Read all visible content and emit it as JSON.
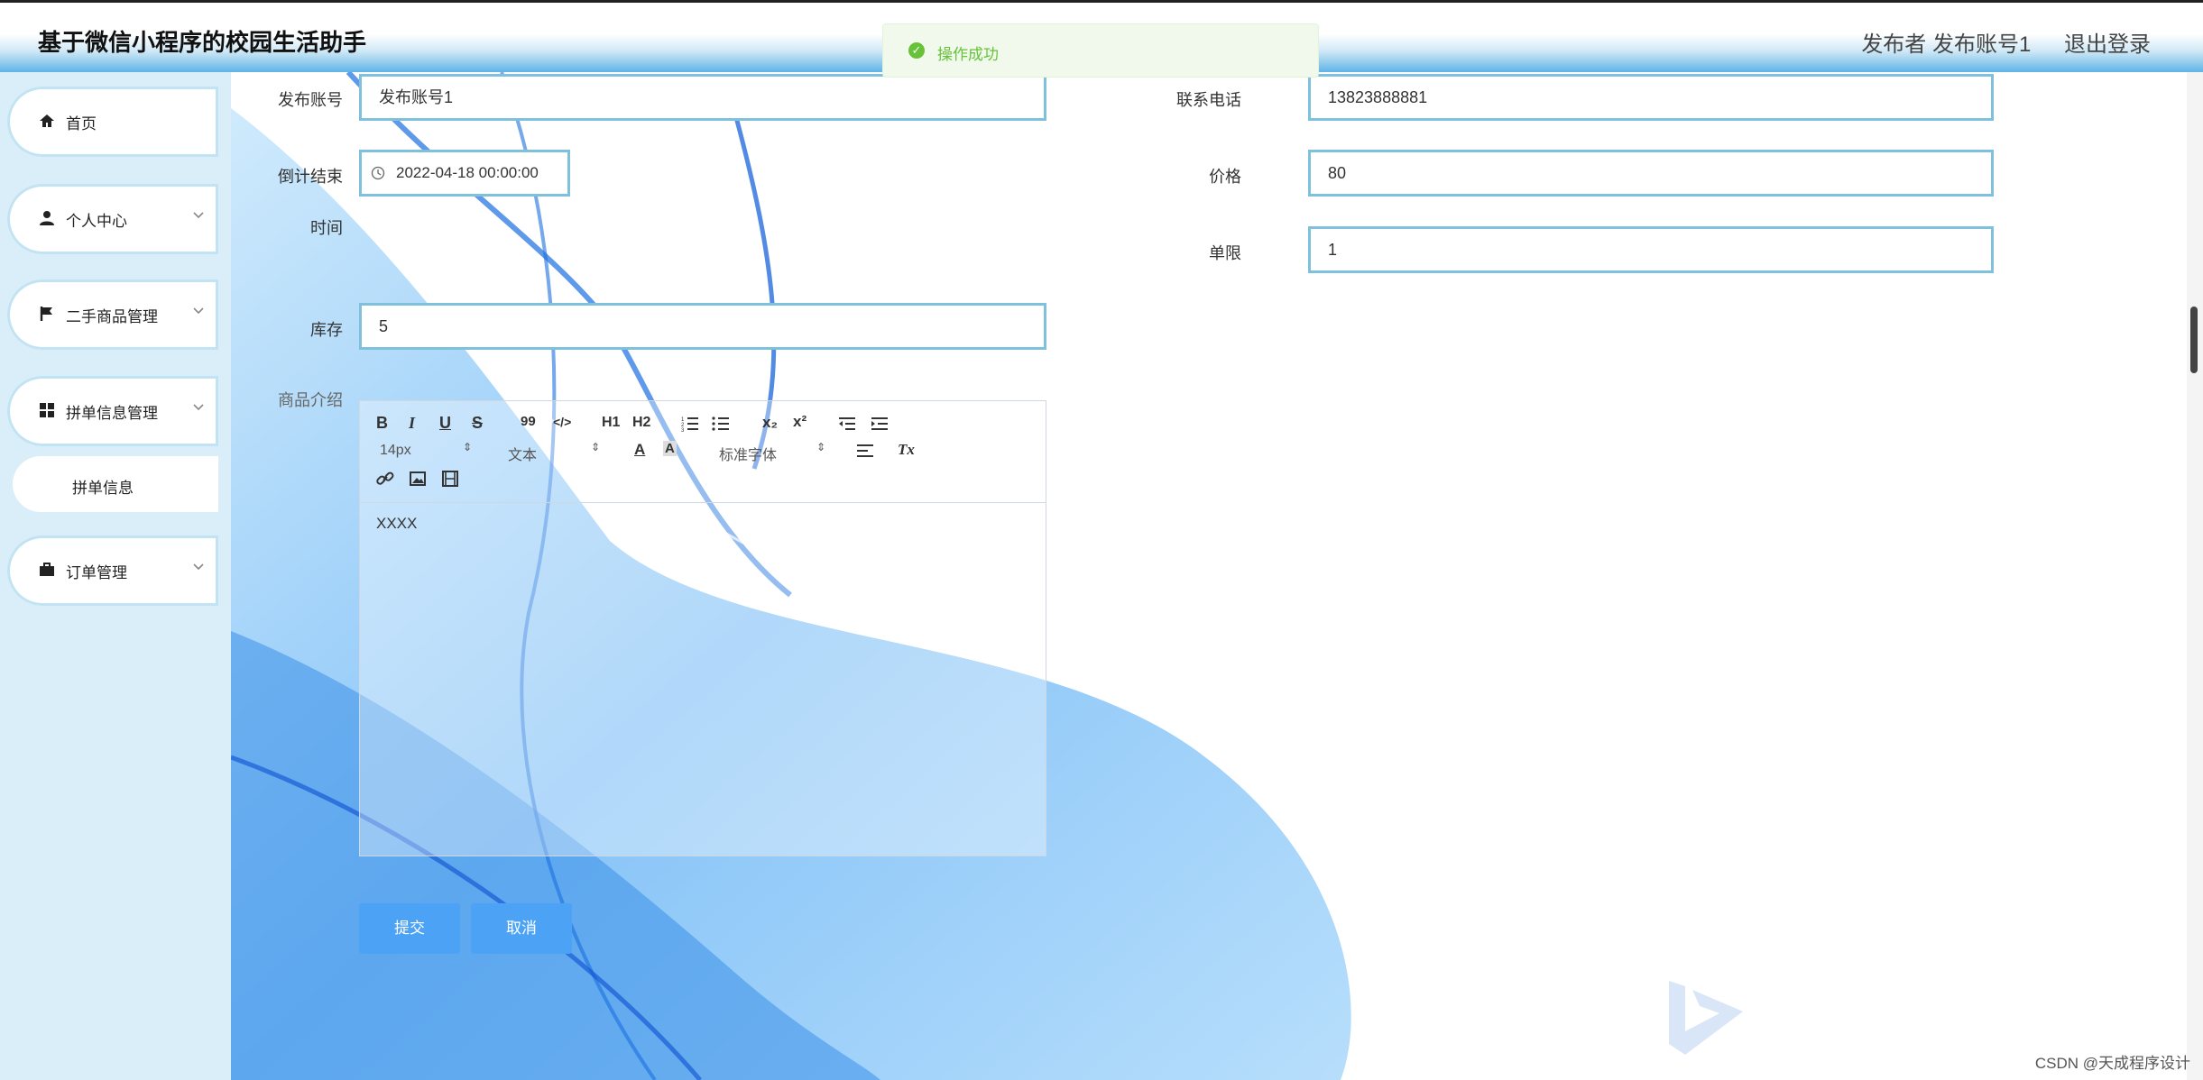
{
  "header": {
    "title": "基于微信小程序的校园生活助手",
    "user": "发布者 发布账号1",
    "logout": "退出登录"
  },
  "toast": {
    "message": "操作成功",
    "color": "#67c23a"
  },
  "sidebar": {
    "items": [
      {
        "label": "首页",
        "icon": "home-icon"
      },
      {
        "label": "个人中心",
        "icon": "user-icon"
      },
      {
        "label": "二手商品管理",
        "icon": "flag-icon"
      },
      {
        "label": "拼单信息管理",
        "icon": "grid-icon"
      },
      {
        "label": "订单管理",
        "icon": "briefcase-icon"
      }
    ],
    "sub_item": "拼单信息"
  },
  "form": {
    "account_label": "发布账号",
    "account_value": "发布账号1",
    "phone_label": "联系电话",
    "phone_value": "13823888881",
    "countdown_label_1": "倒计结束",
    "countdown_label_2": "时间",
    "countdown_value": "2022-04-18 00:00:00",
    "price_label": "价格",
    "price_value": "80",
    "limit_label": "单限",
    "limit_value": "1",
    "stock_label": "库存",
    "stock_value": "5",
    "intro_label": "商品介绍",
    "intro_value": "XXXX"
  },
  "editor_toolbar": {
    "bold": "B",
    "italic": "I",
    "underline": "U",
    "strike": "S",
    "quote": "99",
    "code": "</>",
    "h1": "H1",
    "h2": "H2",
    "sub": "x₂",
    "sup": "x²",
    "font_size": "14px",
    "paragraph": "文本",
    "font_family": "标准字体",
    "clear": "Tx"
  },
  "buttons": {
    "submit": "提交",
    "cancel": "取消"
  },
  "watermark": "CSDN @天成程序设计",
  "colors": {
    "accent": "#4ca3f5",
    "field_border": "#7fc1dc",
    "sidebar_bg": "#d9eef8"
  }
}
